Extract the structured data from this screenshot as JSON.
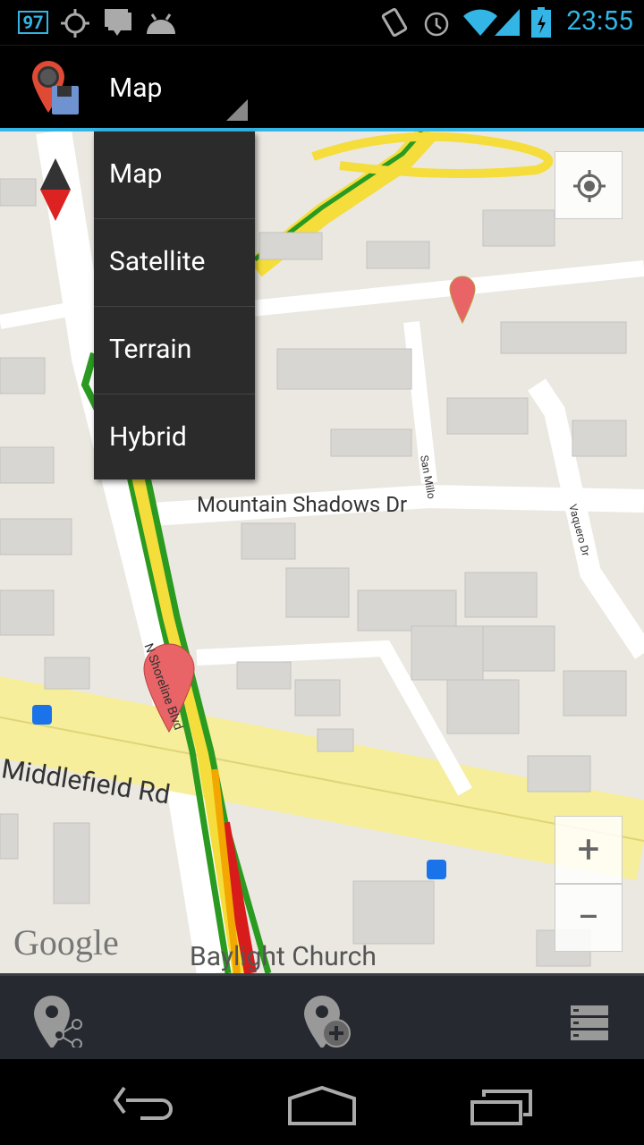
{
  "status_bar": {
    "notification_badge": "97",
    "time": "23:55",
    "icons": [
      "gps-icon",
      "chat-icon",
      "android-icon",
      "vibrate-icon",
      "alarm-icon",
      "wifi-icon",
      "signal-icon",
      "battery-charging-icon"
    ],
    "accent_color": "#33b5e5"
  },
  "action_bar": {
    "app_icon": "map-pin-save-icon",
    "spinner_selected": "Map"
  },
  "dropdown": {
    "options": [
      "Map",
      "Satellite",
      "Terrain",
      "Hybrid"
    ]
  },
  "map": {
    "labels": {
      "mountain_shadows": "Mountain Shadows Dr",
      "middlefield": "Middlefield Rd",
      "baylight": "Baylight Church",
      "shoreline": "N Shoreline Blvd",
      "san_millo": "San Millo",
      "vaquero": "Vaquero Dr",
      "google": "Google"
    },
    "zoom_in": "+",
    "zoom_out": "−"
  },
  "bottom_bar": {
    "icons": [
      "share-location-icon",
      "add-location-icon",
      "list-icon"
    ]
  },
  "nav_bar": {
    "icons": [
      "back-icon",
      "home-icon",
      "recent-apps-icon"
    ]
  }
}
